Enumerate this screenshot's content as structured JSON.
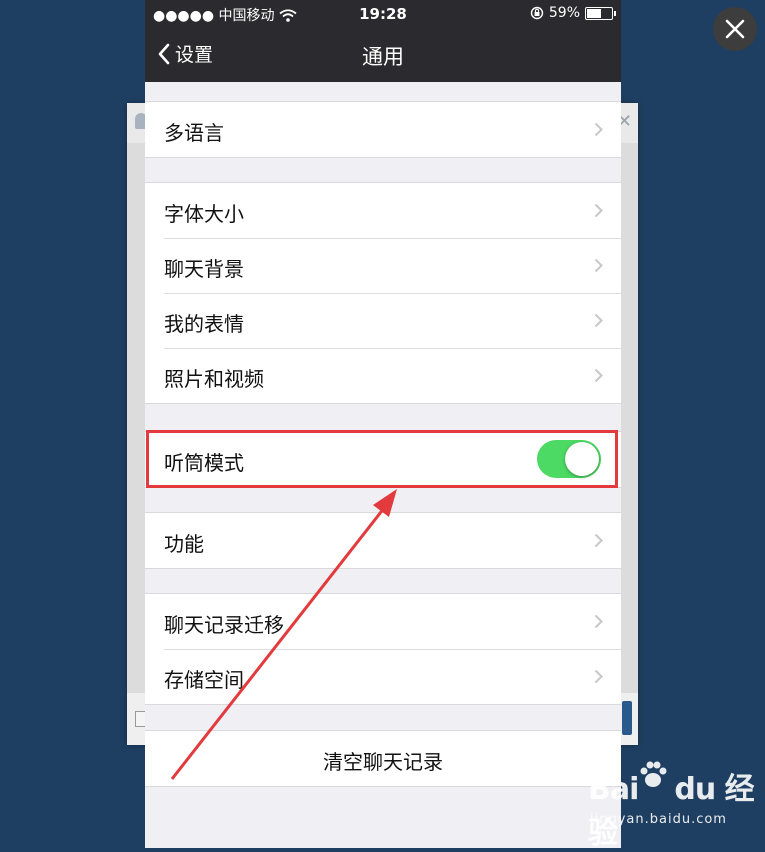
{
  "status_bar": {
    "carrier": "●●●●● 中国移动",
    "time": "19:28",
    "battery": "59%"
  },
  "nav": {
    "back_label": "设置",
    "title": "通用"
  },
  "groups": {
    "language": "多语言",
    "font_size": "字体大小",
    "chat_background": "聊天背景",
    "my_stickers": "我的表情",
    "photos_videos": "照片和视频",
    "earpiece_mode": "听筒模式",
    "earpiece_mode_on": true,
    "features": "功能",
    "chat_migration": "聊天记录迁移",
    "storage": "存储空间",
    "clear_history": "清空聊天记录"
  },
  "colors": {
    "toggle_on": "#4cd964",
    "highlight": "#e23a3d",
    "nav_bg": "#2b2a2f"
  },
  "watermark": {
    "logo": "Bai du 经验",
    "url": "jingyan.baidu.com"
  }
}
